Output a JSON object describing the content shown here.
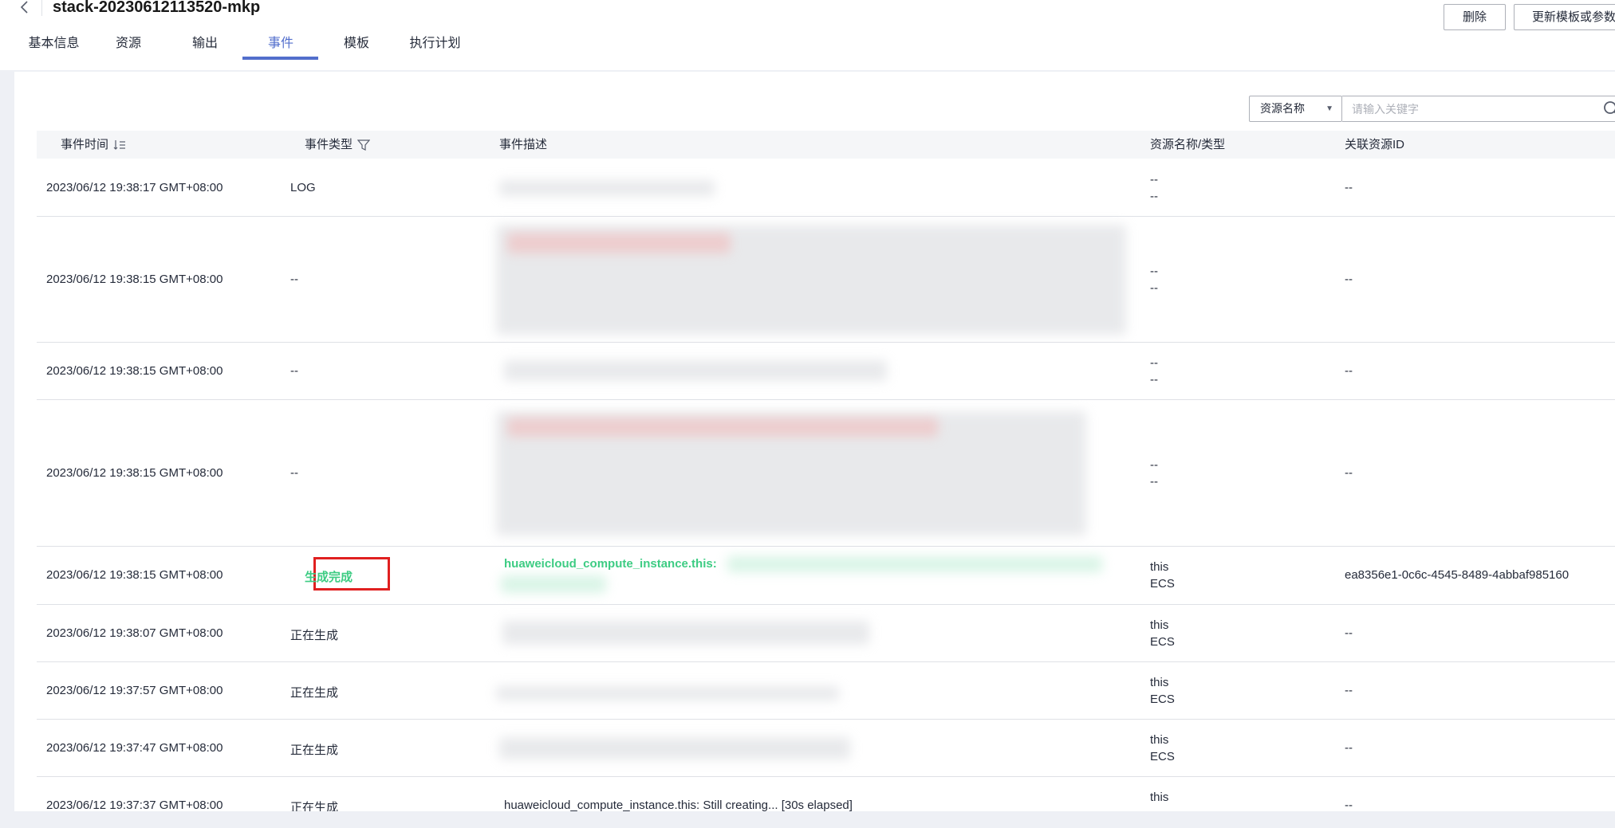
{
  "header": {
    "back_icon": "chevron-left-icon",
    "title": "stack-20230612113520-mkp",
    "delete_label": "删除",
    "update_label": "更新模板或参数"
  },
  "tabs": [
    {
      "label": "基本信息",
      "active": false
    },
    {
      "label": "资源",
      "active": false
    },
    {
      "label": "输出",
      "active": false
    },
    {
      "label": "事件",
      "active": true
    },
    {
      "label": "模板",
      "active": false
    },
    {
      "label": "执行计划",
      "active": false
    }
  ],
  "filter": {
    "select_value": "资源名称",
    "search_placeholder": "请输入关键字"
  },
  "table": {
    "columns": [
      "事件时间",
      "事件类型",
      "事件描述",
      "资源名称/类型",
      "关联资源ID"
    ],
    "rows": [
      {
        "time": "2023/06/12 19:38:17 GMT+08:00",
        "type": "LOG",
        "desc": "",
        "res_name": "--",
        "res_type": "--",
        "res_id": "--"
      },
      {
        "time": "2023/06/12 19:38:15 GMT+08:00",
        "type": "--",
        "desc": "",
        "res_name": "--",
        "res_type": "--",
        "res_id": "--"
      },
      {
        "time": "2023/06/12 19:38:15 GMT+08:00",
        "type": "--",
        "desc": "",
        "res_name": "--",
        "res_type": "--",
        "res_id": "--"
      },
      {
        "time": "2023/06/12 19:38:15 GMT+08:00",
        "type": "--",
        "desc": "",
        "res_name": "--",
        "res_type": "--",
        "res_id": "--"
      },
      {
        "time": "2023/06/12 19:38:15 GMT+08:00",
        "type": "生成完成",
        "desc": "huaweicloud_compute_instance.this:",
        "res_name": "this",
        "res_type": "ECS",
        "res_id": "ea8356e1-0c6c-4545-8489-4abbaf985160"
      },
      {
        "time": "2023/06/12 19:38:07 GMT+08:00",
        "type": "正在生成",
        "desc": "",
        "res_name": "this",
        "res_type": "ECS",
        "res_id": "--"
      },
      {
        "time": "2023/06/12 19:37:57 GMT+08:00",
        "type": "正在生成",
        "desc": "",
        "res_name": "this",
        "res_type": "ECS",
        "res_id": "--"
      },
      {
        "time": "2023/06/12 19:37:47 GMT+08:00",
        "type": "正在生成",
        "desc": "",
        "res_name": "this",
        "res_type": "ECS",
        "res_id": "--"
      },
      {
        "time": "2023/06/12 19:37:37 GMT+08:00",
        "type": "正在生成",
        "desc": "huaweicloud_compute_instance.this: Still creating... [30s elapsed]",
        "res_name": "this",
        "res_type": "",
        "res_id": "--"
      }
    ]
  },
  "colors": {
    "accent": "#526ecc",
    "success": "#3dcc83",
    "highlight_box": "#e02020"
  }
}
